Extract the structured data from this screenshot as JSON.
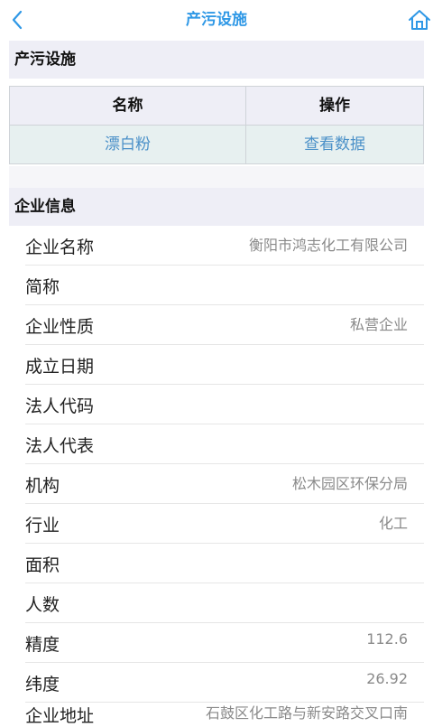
{
  "nav": {
    "title": "产污设施"
  },
  "facilities": {
    "section_title": "产污设施",
    "columns": [
      "名称",
      "操作"
    ],
    "rows": [
      {
        "name": "漂白粉",
        "action": "查看数据"
      }
    ]
  },
  "company": {
    "section_title": "企业信息",
    "fields": [
      {
        "label": "企业名称",
        "value": "衡阳市鸿志化工有限公司"
      },
      {
        "label": "简称",
        "value": ""
      },
      {
        "label": "企业性质",
        "value": "私营企业"
      },
      {
        "label": "成立日期",
        "value": ""
      },
      {
        "label": "法人代码",
        "value": ""
      },
      {
        "label": "法人代表",
        "value": ""
      },
      {
        "label": "机构",
        "value": "松木园区环保分局"
      },
      {
        "label": "行业",
        "value": "化工"
      },
      {
        "label": "面积",
        "value": ""
      },
      {
        "label": "人数",
        "value": ""
      },
      {
        "label": "精度",
        "value": "112.6"
      },
      {
        "label": "纬度",
        "value": "26.92"
      },
      {
        "label": "企业地址",
        "value": "石鼓区化工路与新安路交叉口南"
      }
    ]
  },
  "colors": {
    "accent": "#2f98e6",
    "section_bg": "#eeeef6",
    "row_bg": "#e7f0f0"
  },
  "icons": {
    "back": "chevron-left-icon",
    "home": "home-icon"
  }
}
